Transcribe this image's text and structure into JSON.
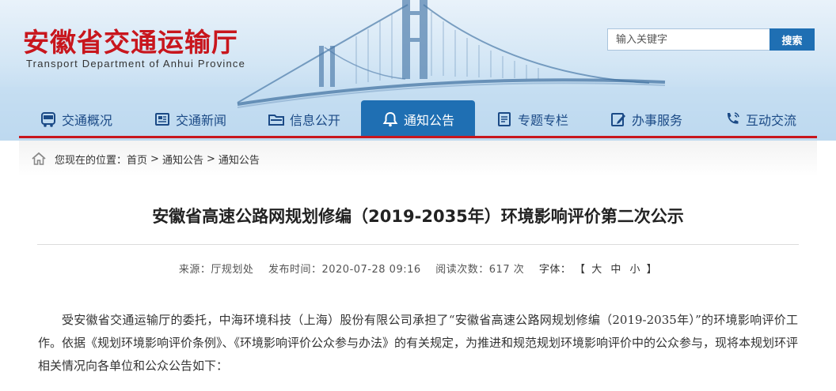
{
  "site": {
    "name_cn": "安徽省交通运输厅",
    "name_en": "Transport Department of Anhui Province"
  },
  "search": {
    "placeholder": "输入关键字",
    "button_label": "搜索"
  },
  "nav": {
    "items": [
      {
        "label": "交通概况",
        "icon": "bus-icon"
      },
      {
        "label": "交通新闻",
        "icon": "newspaper-icon"
      },
      {
        "label": "信息公开",
        "icon": "folder-icon"
      },
      {
        "label": "通知公告",
        "icon": "bell-icon",
        "active": true
      },
      {
        "label": "专题专栏",
        "icon": "document-icon"
      },
      {
        "label": "办事服务",
        "icon": "edit-icon"
      },
      {
        "label": "互动交流",
        "icon": "phone-icon"
      }
    ]
  },
  "breadcrumb": {
    "prefix": "您现在的位置：",
    "items": [
      "首页",
      "通知公告",
      "通知公告"
    ],
    "separator": ">"
  },
  "article": {
    "title": "安徽省高速公路网规划修编（2019-2035年）环境影响评价第二次公示",
    "meta": {
      "source": "来源：厅规划处",
      "publish_time": "发布时间：2020-07-28 09:16",
      "views": "阅读次数：617 次",
      "font_label": "字体：",
      "font_open": "【",
      "font_large": "大",
      "font_medium": "中",
      "font_small": "小",
      "font_close": "】"
    },
    "body": "受安徽省交通运输厅的委托，中海环境科技（上海）股份有限公司承担了“安徽省高速公路网规划修编（2019-2035年）”的环境影响评价工作。依据《规划环境影响评价条例》、《环境影响评价公众参与办法》的有关规定，为推进和规范规划环境影响评价中的公众参与，现将本规划环评相关情况向各单位和公众公告如下："
  },
  "colors": {
    "brand_red": "#c8161d",
    "nav_blue": "#1f6fb3",
    "nav_text": "#1b4a86"
  }
}
